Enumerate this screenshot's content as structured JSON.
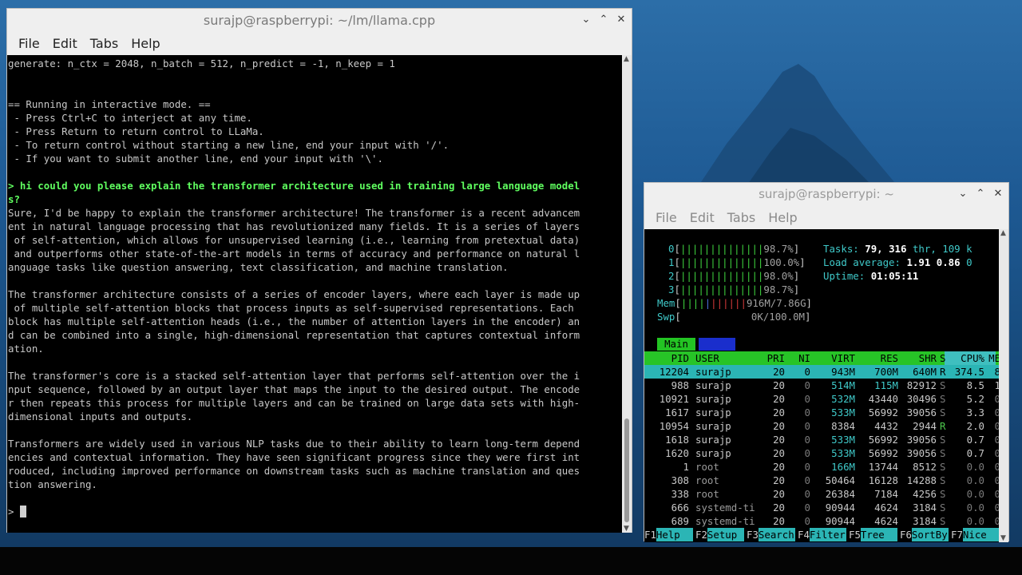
{
  "terminal1": {
    "title": "surajp@raspberrypi: ~/lm/llama.cpp",
    "menu": [
      "File",
      "Edit",
      "Tabs",
      "Help"
    ],
    "lines": [
      {
        "text": "generate: n_ctx = 2048, n_batch = 512, n_predict = -1, n_keep = 1",
        "type": "normal"
      },
      {
        "text": "",
        "type": "normal"
      },
      {
        "text": "",
        "type": "normal"
      },
      {
        "text": "== Running in interactive mode. ==",
        "type": "normal"
      },
      {
        "text": " - Press Ctrl+C to interject at any time.",
        "type": "normal"
      },
      {
        "text": " - Press Return to return control to LLaMa.",
        "type": "normal"
      },
      {
        "text": " - To return control without starting a new line, end your input with '/'.",
        "type": "normal"
      },
      {
        "text": " - If you want to submit another line, end your input with '\\'.",
        "type": "normal"
      },
      {
        "text": "",
        "type": "normal"
      },
      {
        "text": "> hi could you please explain the transformer architecture used in training large language model",
        "type": "user"
      },
      {
        "text": "s?",
        "type": "user"
      },
      {
        "text": "Sure, I'd be happy to explain the transformer architecture! The transformer is a recent advancem",
        "type": "normal"
      },
      {
        "text": "ent in natural language processing that has revolutionized many fields. It is a series of layers",
        "type": "normal"
      },
      {
        "text": " of self-attention, which allows for unsupervised learning (i.e., learning from pretextual data)",
        "type": "normal"
      },
      {
        "text": " and outperforms other state-of-the-art models in terms of accuracy and performance on natural l",
        "type": "normal"
      },
      {
        "text": "anguage tasks like question answering, text classification, and machine translation.",
        "type": "normal"
      },
      {
        "text": "",
        "type": "normal"
      },
      {
        "text": "The transformer architecture consists of a series of encoder layers, where each layer is made up",
        "type": "normal"
      },
      {
        "text": " of multiple self-attention blocks that process inputs as self-supervised representations. Each",
        "type": "normal"
      },
      {
        "text": "block has multiple self-attention heads (i.e., the number of attention layers in the encoder) an",
        "type": "normal"
      },
      {
        "text": "d can be combined into a single, high-dimensional representation that captures contextual inform",
        "type": "normal"
      },
      {
        "text": "ation.",
        "type": "normal"
      },
      {
        "text": "",
        "type": "normal"
      },
      {
        "text": "The transformer's core is a stacked self-attention layer that performs self-attention over the i",
        "type": "normal"
      },
      {
        "text": "nput sequence, followed by an output layer that maps the input to the desired output. The encode",
        "type": "normal"
      },
      {
        "text": "r then repeats this process for multiple layers and can be trained on large data sets with high-",
        "type": "normal"
      },
      {
        "text": "dimensional inputs and outputs.",
        "type": "normal"
      },
      {
        "text": "",
        "type": "normal"
      },
      {
        "text": "Transformers are widely used in various NLP tasks due to their ability to learn long-term depend",
        "type": "normal"
      },
      {
        "text": "encies and contextual information. They have seen significant progress since they were first int",
        "type": "normal"
      },
      {
        "text": "roduced, including improved performance on downstream tasks such as machine translation and ques",
        "type": "normal"
      },
      {
        "text": "tion answering.",
        "type": "normal"
      },
      {
        "text": "",
        "type": "normal"
      }
    ],
    "prompt": "> "
  },
  "terminal2": {
    "title": "surajp@raspberrypi: ~",
    "menu": [
      "File",
      "Edit",
      "Tabs",
      "Help"
    ],
    "cpus": [
      {
        "id": "0",
        "bars": "||||||||||||||",
        "pct": "98.7%"
      },
      {
        "id": "1",
        "bars": "||||||||||||||",
        "pct": "100.0%"
      },
      {
        "id": "2",
        "bars": "||||||||||||||",
        "pct": "98.0%"
      },
      {
        "id": "3",
        "bars": "||||||||||||||",
        "pct": "98.7%"
      }
    ],
    "mem": {
      "label": "Mem",
      "bars_green": "||||",
      "bars_blue": "|",
      "bars_red": "||||||",
      "value": "916M/7.86G"
    },
    "swp": {
      "label": "Swp",
      "value": "0K/100.0M"
    },
    "tasks": {
      "label": "Tasks:",
      "count": "79,",
      "thr": "316",
      "thr_label": "thr,",
      "kthr": "109 k"
    },
    "load": {
      "label": "Load average:",
      "v1": "1.91",
      "v2": "0.86",
      "v3": "0"
    },
    "uptime": {
      "label": "Uptime:",
      "value": "01:05:11"
    },
    "tab_main": "Main",
    "columns": [
      "PID",
      "USER",
      "PRI",
      "NI",
      "VIRT",
      "RES",
      "SHR",
      "S",
      "CPU%",
      "ME"
    ],
    "processes": [
      {
        "pid": "12204",
        "user": "surajp",
        "pri": "20",
        "ni": "0",
        "virt": "943M",
        "res": "700M",
        "shr": "640M",
        "s": "R",
        "cpu": "374.5",
        "mem": "8"
      },
      {
        "pid": "988",
        "user": "surajp",
        "pri": "20",
        "ni": "0",
        "virt": "514M",
        "res": "115M",
        "shr": "82912",
        "s": "S",
        "cpu": "8.5",
        "mem": "1"
      },
      {
        "pid": "10921",
        "user": "surajp",
        "pri": "20",
        "ni": "0",
        "virt": "532M",
        "res": "43440",
        "shr": "30496",
        "s": "S",
        "cpu": "5.2",
        "mem": "0"
      },
      {
        "pid": "1617",
        "user": "surajp",
        "pri": "20",
        "ni": "0",
        "virt": "533M",
        "res": "56992",
        "shr": "39056",
        "s": "S",
        "cpu": "3.3",
        "mem": "0"
      },
      {
        "pid": "10954",
        "user": "surajp",
        "pri": "20",
        "ni": "0",
        "virt": "8384",
        "res": "4432",
        "shr": "2944",
        "s": "R",
        "cpu": "2.0",
        "mem": "0"
      },
      {
        "pid": "1618",
        "user": "surajp",
        "pri": "20",
        "ni": "0",
        "virt": "533M",
        "res": "56992",
        "shr": "39056",
        "s": "S",
        "cpu": "0.7",
        "mem": "0"
      },
      {
        "pid": "1620",
        "user": "surajp",
        "pri": "20",
        "ni": "0",
        "virt": "533M",
        "res": "56992",
        "shr": "39056",
        "s": "S",
        "cpu": "0.7",
        "mem": "0"
      },
      {
        "pid": "1",
        "user": "root",
        "pri": "20",
        "ni": "0",
        "virt": "166M",
        "res": "13744",
        "shr": "8512",
        "s": "S",
        "cpu": "0.0",
        "mem": "0"
      },
      {
        "pid": "308",
        "user": "root",
        "pri": "20",
        "ni": "0",
        "virt": "50464",
        "res": "16128",
        "shr": "14288",
        "s": "S",
        "cpu": "0.0",
        "mem": "0"
      },
      {
        "pid": "338",
        "user": "root",
        "pri": "20",
        "ni": "0",
        "virt": "26384",
        "res": "7184",
        "shr": "4256",
        "s": "S",
        "cpu": "0.0",
        "mem": "0"
      },
      {
        "pid": "666",
        "user": "systemd-ti",
        "pri": "20",
        "ni": "0",
        "virt": "90944",
        "res": "4624",
        "shr": "3184",
        "s": "S",
        "cpu": "0.0",
        "mem": "0"
      },
      {
        "pid": "689",
        "user": "systemd-ti",
        "pri": "20",
        "ni": "0",
        "virt": "90944",
        "res": "4624",
        "shr": "3184",
        "s": "S",
        "cpu": "0.0",
        "mem": "0"
      }
    ],
    "fkeys": [
      {
        "num": "F1",
        "label": "Help"
      },
      {
        "num": "F2",
        "label": "Setup"
      },
      {
        "num": "F3",
        "label": "Search"
      },
      {
        "num": "F4",
        "label": "Filter"
      },
      {
        "num": "F5",
        "label": "Tree"
      },
      {
        "num": "F6",
        "label": "SortBy"
      },
      {
        "num": "F7",
        "label": "Nice"
      }
    ]
  },
  "colors": {
    "terminal_bg": "#000000",
    "user_input": "#60ff60",
    "htop_cyan": "#3fc9c9",
    "htop_green": "#27c427",
    "htop_selected": "#2bb5b5"
  }
}
